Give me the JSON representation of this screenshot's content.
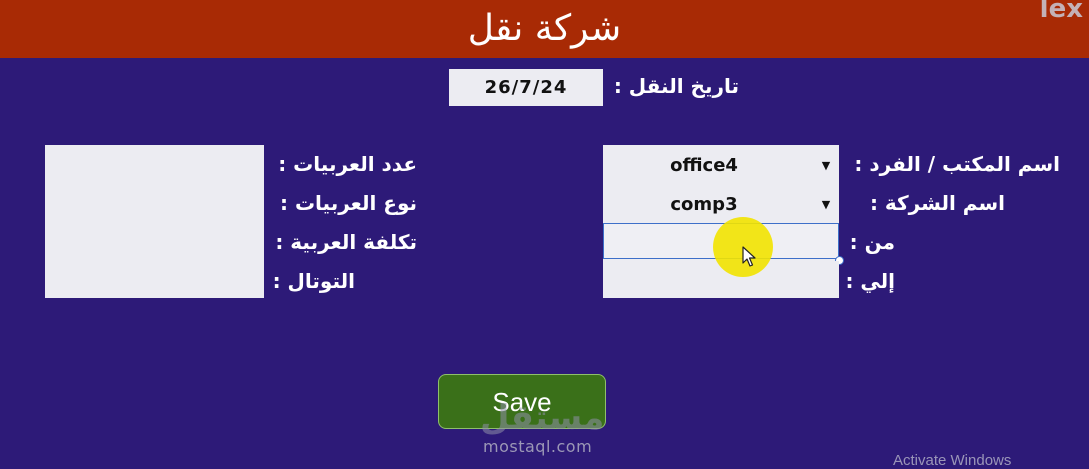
{
  "header": {
    "title": "شركة نقل",
    "corner_logo": "lex"
  },
  "date": {
    "label": "تاريخ النقل :",
    "value": "26/7/24"
  },
  "right_form": {
    "office_label": "اسم المكتب / الفرد :",
    "office_value": "office4",
    "company_label": "اسم الشركة :",
    "company_value": "comp3",
    "from_label": "من :",
    "from_value": "",
    "to_label": "إلي :",
    "to_value": ""
  },
  "left_form": {
    "count_label": "عدد العربيات :",
    "type_label": "نوع العربيات :",
    "cost_label": "تكلفة العربية :",
    "total_label": "التوتال :"
  },
  "actions": {
    "save_label": "Save"
  },
  "watermark": {
    "logo": "مستقل",
    "site": "mostaql.com"
  },
  "system": {
    "activate": "Activate Windows"
  },
  "colors": {
    "background": "#2d1a78",
    "header": "#a82a05",
    "save": "#3a7019",
    "field": "#ececf2",
    "focus": "#3d6fc9"
  }
}
